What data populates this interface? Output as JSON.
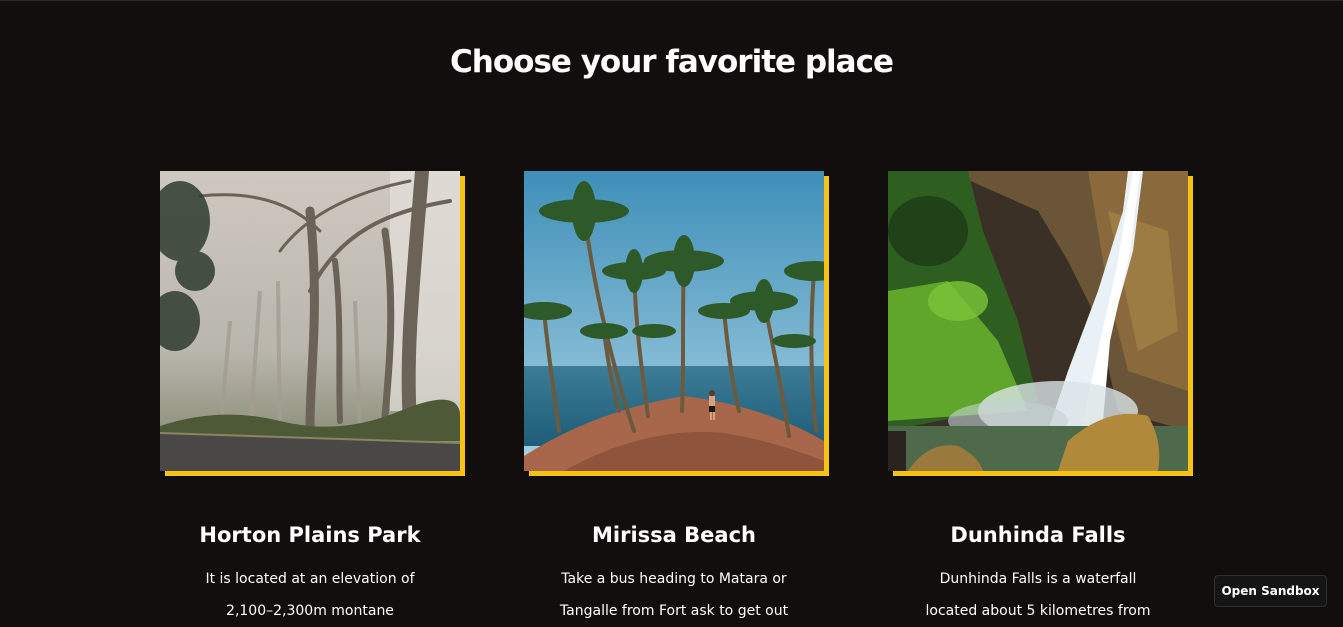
{
  "page": {
    "title": "Choose your favorite place"
  },
  "places": [
    {
      "name": "Horton Plains Park",
      "description_lines": [
        "It is located at an elevation of",
        "2,100–2,300m montane"
      ],
      "image": "misty-forest-road-photo"
    },
    {
      "name": "Mirissa Beach",
      "description_lines": [
        "Take a bus heading to Matara or",
        "Tangalle from Fort ask to get out"
      ],
      "image": "palm-trees-beach-photo"
    },
    {
      "name": "Dunhinda Falls",
      "description_lines": [
        "Dunhinda Falls is a waterfall",
        "located about 5 kilometres from"
      ],
      "image": "waterfall-photo"
    }
  ],
  "sandbox_button": {
    "label": "Open Sandbox"
  },
  "colors": {
    "background": "#120e0e",
    "accent": "#f6c315",
    "text": "#ffffff"
  }
}
